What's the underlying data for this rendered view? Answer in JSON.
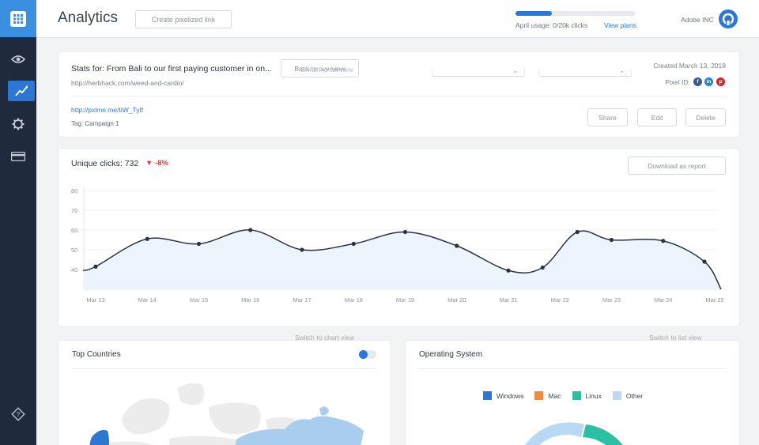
{
  "header": {
    "title": "Analytics",
    "create_button": "Create pixelized link",
    "usage_text": "April usage: 0/20k clicks",
    "usage_fraction": 0.3,
    "view_plans": "View plans",
    "company": "Adobe INC"
  },
  "sidebar": {
    "items": [
      {
        "icon": "grid-icon"
      },
      {
        "icon": "eye-icon"
      },
      {
        "icon": "trend-icon",
        "active": true
      },
      {
        "icon": "gear-icon"
      },
      {
        "icon": "card-icon"
      },
      {
        "icon": "help-icon"
      }
    ]
  },
  "link_card": {
    "title": "Stats for: From Bali to our first paying customer in on...",
    "url": "http://herbhack.com/weed-and-cardio/",
    "back_button": "Back to overview",
    "ghost_text": "Switch to list view",
    "created": "Created March 13, 2018",
    "pixel_label": "Pixel ID:",
    "short_link": "http://pxlme.me/tiW_TyIf",
    "tag": "Tag: Campaign 1",
    "share": "Share",
    "edit": "Edit",
    "delete": "Delete"
  },
  "clicks_card": {
    "title": "Unique clicks: 732",
    "delta": "▼ -8%",
    "download": "Download as report",
    "chart_data": {
      "type": "line",
      "x": [
        "Mar 13",
        "Mar 14",
        "Mar 15",
        "Mar 16",
        "Mar 17",
        "Mar 18",
        "Mar 19",
        "Mar 20",
        "Mar 21",
        "Mar 22",
        "Mar 23",
        "Mar 24",
        "Mar 25"
      ],
      "y_ticks": [
        80,
        70,
        60,
        50,
        40
      ],
      "ylim": [
        30,
        80
      ],
      "points": [
        {
          "x": "Mar 13",
          "y": 39.5,
          "dot": false
        },
        {
          "x": "Mar 13",
          "y": 41.5,
          "dot": true
        },
        {
          "x": "Mar 14",
          "y": 55.5,
          "dot": true
        },
        {
          "x": "Mar 15",
          "y": 53,
          "dot": true
        },
        {
          "x": "Mar 16",
          "y": 60,
          "dot": true
        },
        {
          "x": "Mar 17",
          "y": 50,
          "dot": true
        },
        {
          "x": "Mar 18",
          "y": 53,
          "dot": true
        },
        {
          "x": "Mar 19",
          "y": 59,
          "dot": true
        },
        {
          "x": "Mar 20",
          "y": 52,
          "dot": true
        },
        {
          "x": "Mar 21",
          "y": 39.5,
          "dot": true
        },
        {
          "x": "Mar 22",
          "y": 41,
          "dot": true
        },
        {
          "x": "Mar 22",
          "y": 59,
          "dot": true
        },
        {
          "x": "Mar 23",
          "y": 55,
          "dot": true
        },
        {
          "x": "Mar 24",
          "y": 54.5,
          "dot": true
        },
        {
          "x": "Mar 25",
          "y": 44,
          "dot": true
        },
        {
          "x": "Mar 25",
          "y": 30,
          "dot": false
        }
      ]
    }
  },
  "switch_chart": "Switch to chart view",
  "switch_list": "Switch to list view",
  "countries_card": {
    "title": "Top Countries"
  },
  "os_card": {
    "title": "Operating System",
    "legend": [
      {
        "label": "Windows",
        "color": "#2b77d3"
      },
      {
        "label": "Mac",
        "color": "#f08a3c"
      },
      {
        "label": "Linux",
        "color": "#2bbfa4"
      },
      {
        "label": "Other",
        "color": "#b9d8f3"
      }
    ]
  },
  "colors": {
    "accent": "#2b77d3",
    "sidebar": "#1f2a3c",
    "negative": "#e33b3b"
  }
}
